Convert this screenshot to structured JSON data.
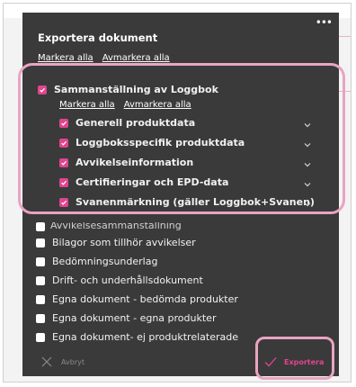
{
  "dialog": {
    "title": "Exportera dokument",
    "more_label": "•••",
    "select_all": "Markera alla",
    "deselect_all": "Avmarkera alla"
  },
  "group": {
    "label": "Sammanställning av Loggbok",
    "checked": true,
    "select_all": "Markera alla",
    "deselect_all": "Avmarkera alla",
    "items": [
      {
        "label": "Generell produktdata",
        "checked": true
      },
      {
        "label": "Loggboksspecifik produktdata",
        "checked": true
      },
      {
        "label": "Avvikelseinformation",
        "checked": true
      },
      {
        "label": "Certifieringar och EPD-data",
        "checked": true
      },
      {
        "label": "Svanenmärkning (gäller Loggbok+Svanen)",
        "checked": true
      }
    ]
  },
  "partially_hidden_item": "Avvikelsesammanställning",
  "documents": [
    {
      "label": "Bilagor som tillhör avvikelser",
      "checked": false
    },
    {
      "label": "Bedömningsunderlag",
      "checked": false
    },
    {
      "label": "Drift- och underhållsdokument",
      "checked": false
    },
    {
      "label": "Egna dokument - bedömda produkter",
      "checked": false
    },
    {
      "label": "Egna dokument - egna produkter",
      "checked": false
    },
    {
      "label": "Egna dokument- ej produktrelaterade",
      "checked": false
    }
  ],
  "footer": {
    "cancel_label": "Avbryt",
    "export_label": "Exportera"
  },
  "colors": {
    "accent": "#e0458d",
    "panel_bg": "#3a3a3a",
    "highlight": "#e9a4c2"
  }
}
